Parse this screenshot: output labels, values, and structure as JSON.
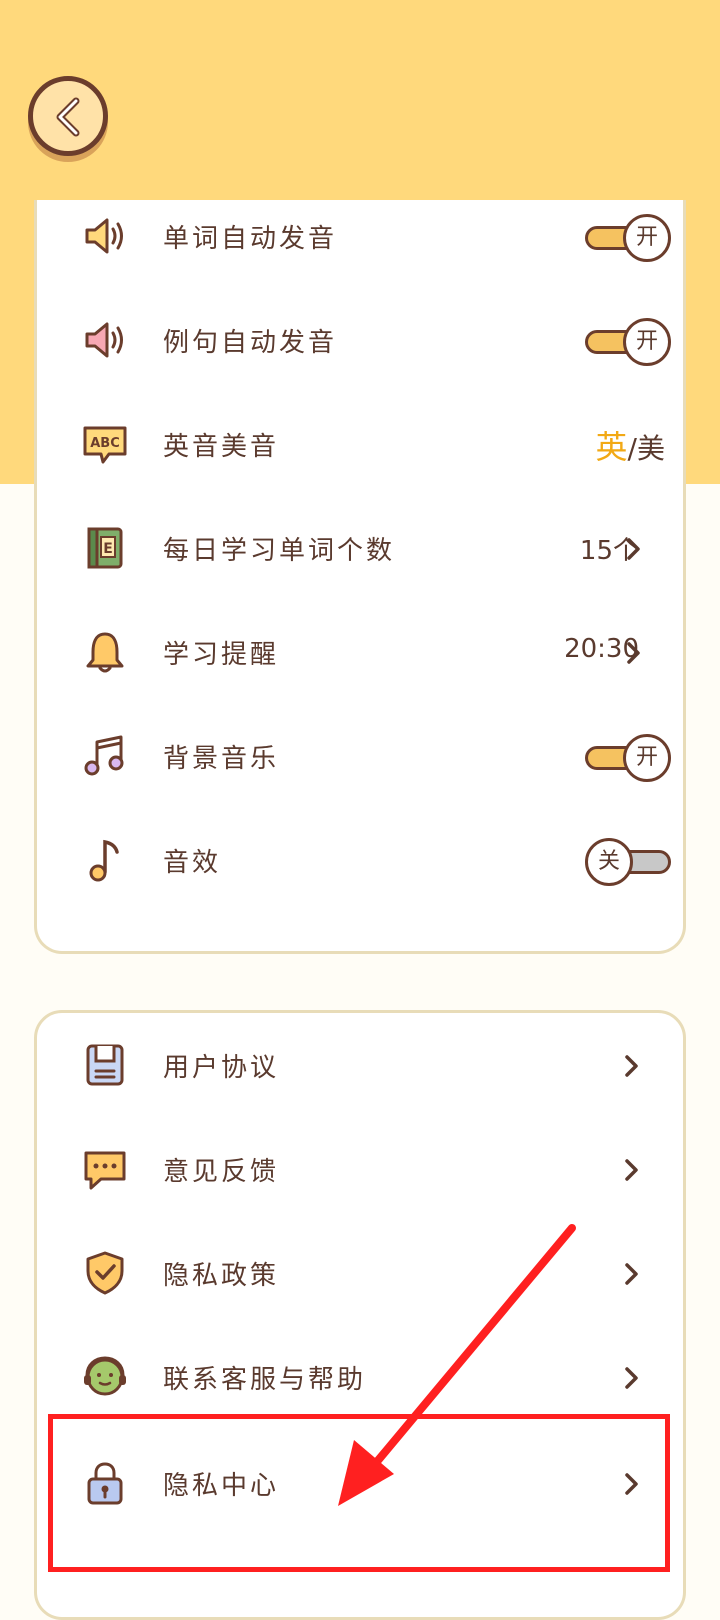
{
  "settings": {
    "items": [
      {
        "label": "单词自动发音",
        "control": "toggle",
        "state": "开"
      },
      {
        "label": "例句自动发音",
        "control": "toggle",
        "state": "开"
      },
      {
        "label": "英音美音",
        "control": "accent",
        "active": "英",
        "separator": "/",
        "other": "美"
      },
      {
        "label": "每日学习单词个数",
        "control": "link",
        "value": "15个"
      },
      {
        "label": "学习提醒",
        "control": "link",
        "value": "20:30"
      },
      {
        "label": "背景音乐",
        "control": "toggle",
        "state": "开"
      },
      {
        "label": "音效",
        "control": "toggle",
        "state": "关"
      }
    ]
  },
  "info": {
    "items": [
      {
        "label": "用户协议"
      },
      {
        "label": "意见反馈"
      },
      {
        "label": "隐私政策"
      },
      {
        "label": "联系客服与帮助"
      },
      {
        "label": "隐私中心"
      }
    ]
  },
  "icons": {
    "back": "back-arrow-icon",
    "speaker_yellow": "speaker-icon",
    "speaker_pink": "speaker-icon",
    "abc": "abc-bubble-icon",
    "book": "book-icon",
    "bell": "bell-icon",
    "music": "music-notes-icon",
    "note": "music-note-icon",
    "document": "document-icon",
    "chat": "chat-bubble-icon",
    "shield": "shield-check-icon",
    "headset": "headset-icon",
    "lock": "lock-icon"
  },
  "colors": {
    "top_background": "#ffd97c",
    "accent": "#f2a915",
    "text": "#5a3a2e",
    "highlight": "#ff2020"
  }
}
